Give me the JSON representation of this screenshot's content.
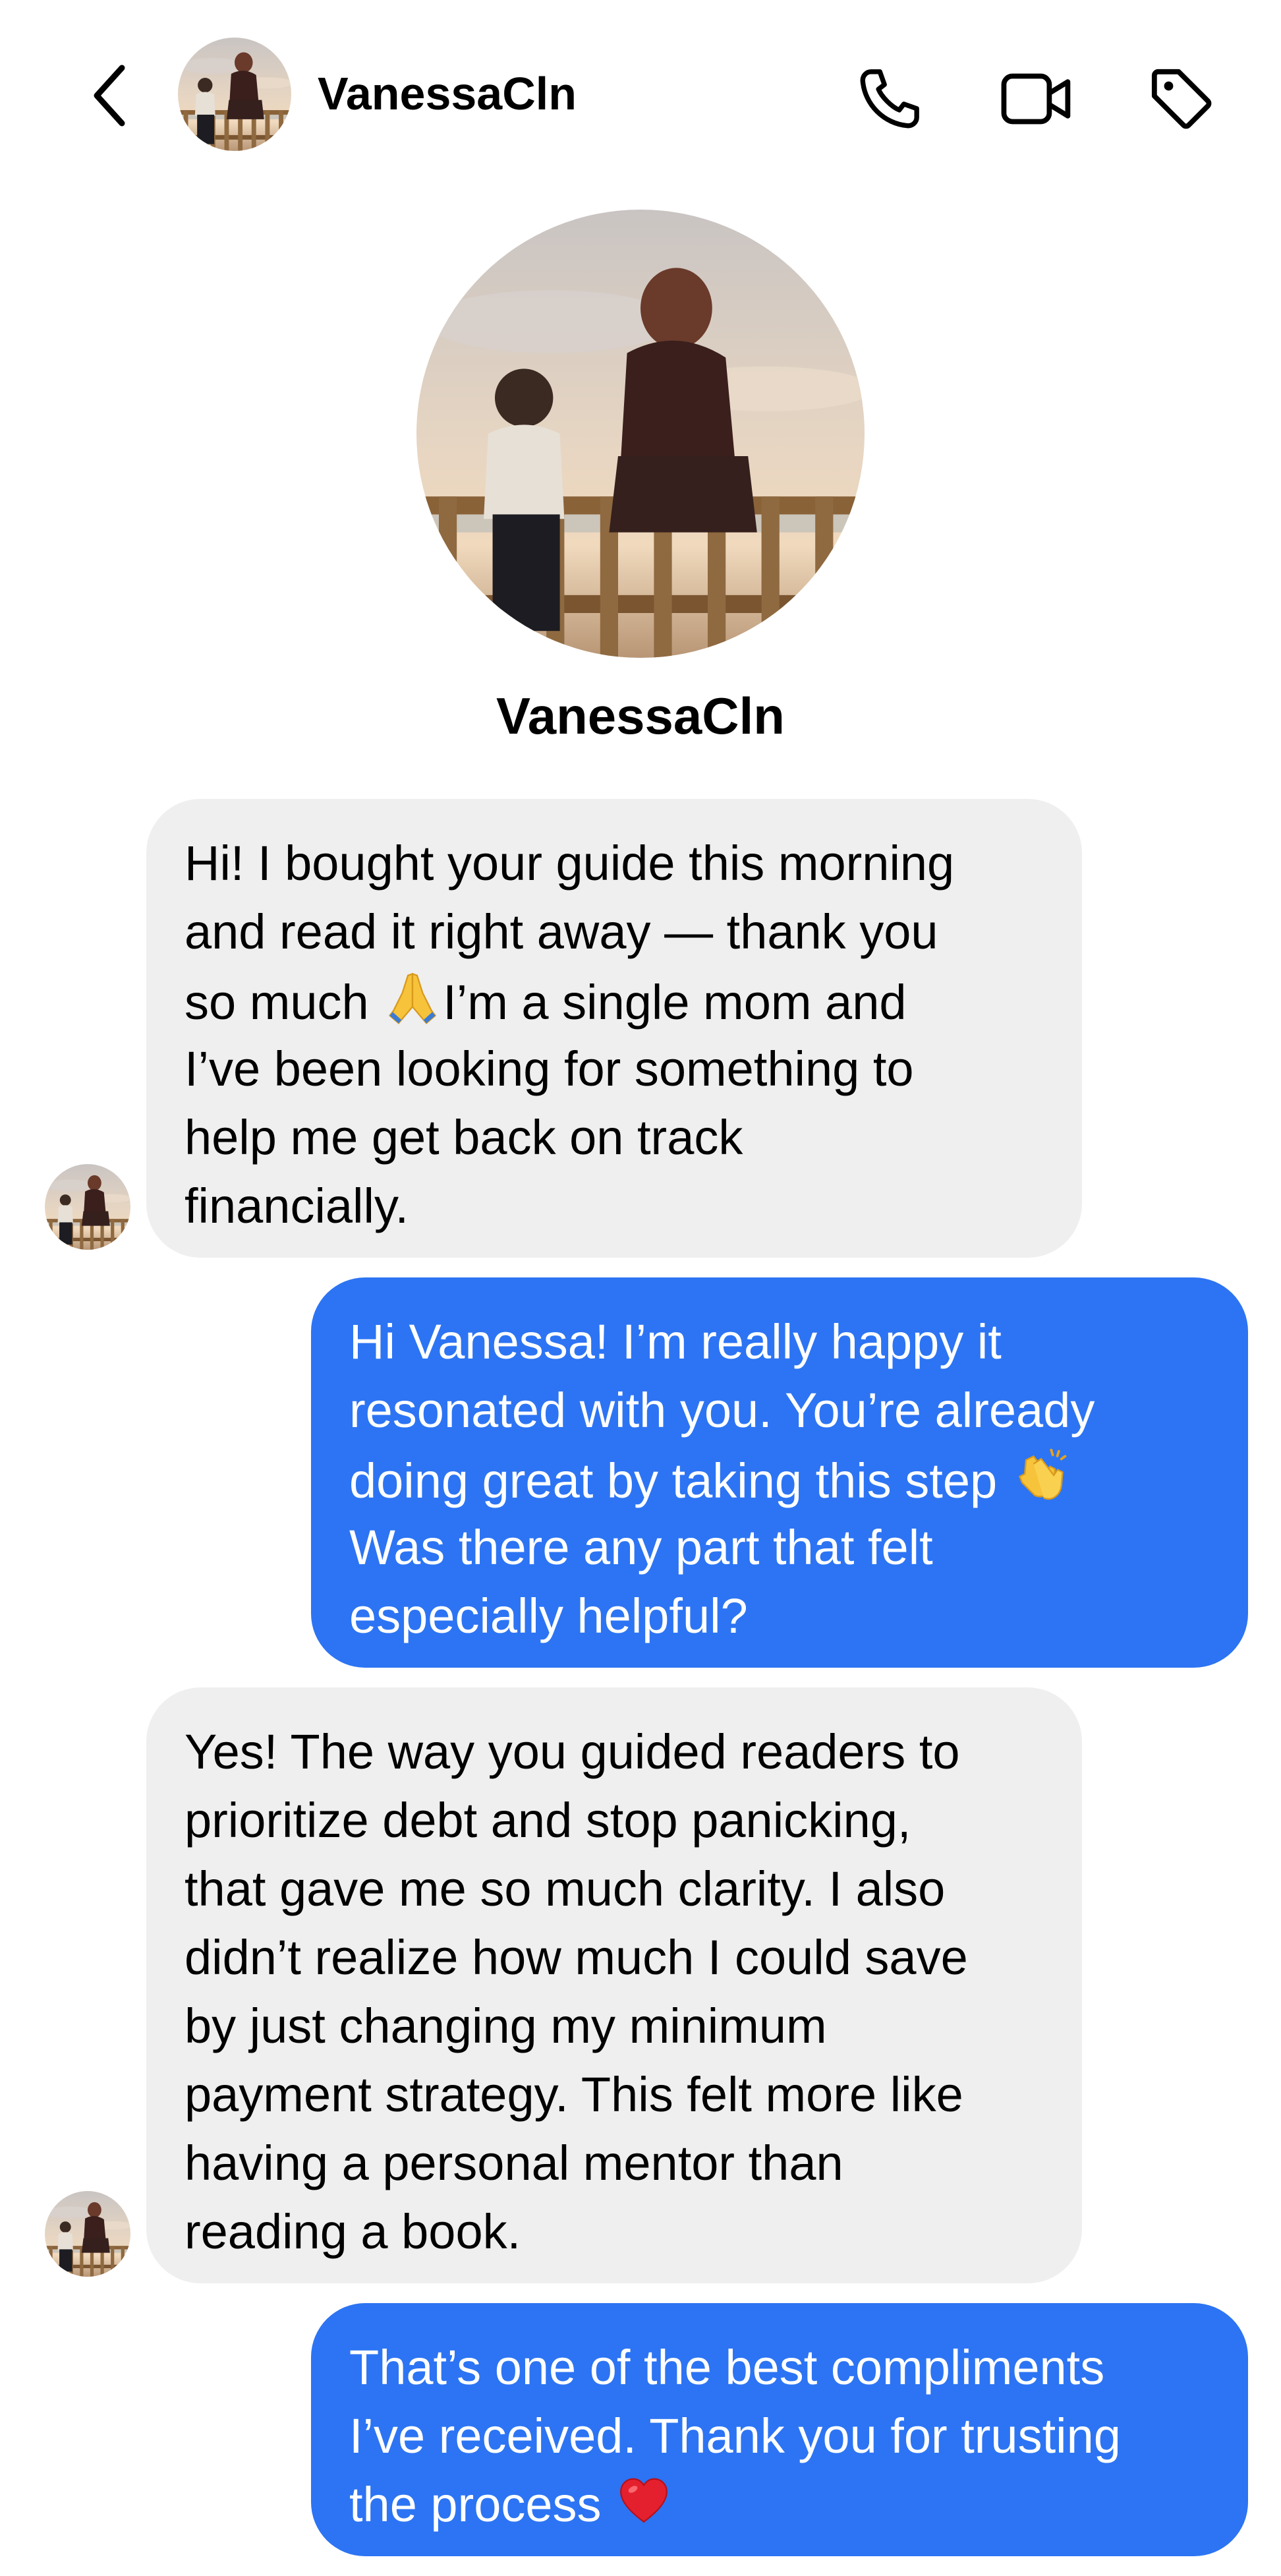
{
  "header": {
    "contact_name": "VanessaCln",
    "icons": {
      "back": "chevron-left-icon",
      "phone": "phone-icon",
      "video": "video-camera-icon",
      "tag": "tag-icon"
    }
  },
  "profile": {
    "name": "VanessaCln"
  },
  "colors": {
    "outgoing_bubble": "#2c74f3",
    "incoming_bubble": "#efefef"
  },
  "messages": [
    {
      "direction": "incoming",
      "lines": [
        "Hi! I bought your guide this morning",
        "and read it right away — thank you",
        "so much ",
        "I’m a single mom and",
        "I’ve been looking for something to",
        "help me get back on track",
        "financially."
      ],
      "emoji": "folded-hands-emoji"
    },
    {
      "direction": "outgoing",
      "lines": [
        "Hi Vanessa! I’m really happy it",
        "resonated with you. You’re already",
        "doing great by taking this step ",
        "Was there any part that felt",
        "especially helpful?"
      ],
      "emoji": "clapping-hands-emoji"
    },
    {
      "direction": "incoming",
      "lines": [
        "Yes! The way you guided readers to",
        "prioritize debt and stop panicking,",
        "that gave me so much clarity. I also",
        "didn’t realize how much I could save",
        "by just changing my minimum",
        "payment strategy. This felt more like",
        "having a personal mentor than",
        "reading a book."
      ]
    },
    {
      "direction": "outgoing",
      "lines": [
        "That’s one of the best compliments",
        "I’ve received. Thank you for trusting",
        "the process "
      ],
      "emoji": "red-heart-emoji"
    }
  ]
}
